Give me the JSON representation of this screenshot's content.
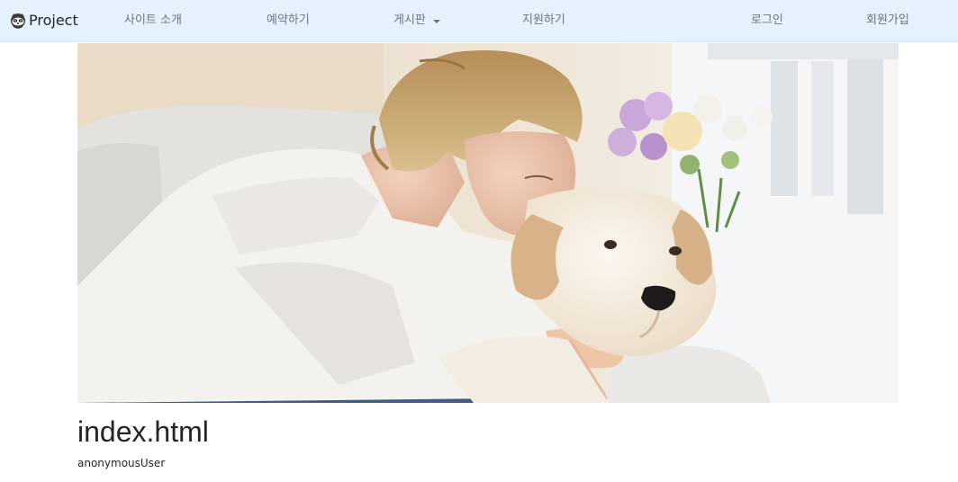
{
  "navbar": {
    "brand": {
      "label": "Project",
      "icon": "raccoon-icon"
    },
    "items": [
      {
        "label": "사이트 소개"
      },
      {
        "label": "예약하기"
      },
      {
        "label": "게시판",
        "dropdown": true
      },
      {
        "label": "지원하기"
      },
      {
        "label": "로그인"
      },
      {
        "label": "회원가입"
      }
    ],
    "colors": {
      "background": "#e3f2fd",
      "text": "#6c757d",
      "brand_text": "#212529"
    }
  },
  "hero": {
    "image_name": "woman-kissing-labrador-dog-photo"
  },
  "content": {
    "heading": "index.html",
    "user": "anonymousUser"
  }
}
